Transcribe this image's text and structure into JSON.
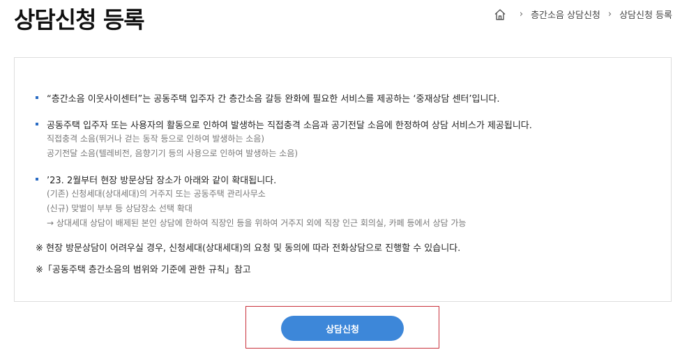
{
  "header": {
    "title": "상담신청 등록",
    "breadcrumb": {
      "home_icon": "home-icon",
      "items": [
        "층간소음 상담신청",
        "상담신청 등록"
      ]
    }
  },
  "notice": {
    "item1": "“층간소음 이웃사이센터”는 공동주택 입주자 간 층간소음 갈등 완화에 필요한 서비스를 제공하는 ‘중재상담 센터’입니다.",
    "item2": {
      "main": "공동주택 입주자 또는 사용자의 활동으로 인하여 발생하는 직접충격 소음과 공기전달 소음에 한정하여 상담 서비스가 제공됩니다.",
      "sub": [
        "직접충격 소음(뛰거나 걷는 동작 등으로 인하여 발생하는 소음)",
        "공기전달 소음(텔레비전, 음향기기 등의 사용으로 인하여 발생하는 소음)"
      ]
    },
    "item3": {
      "main": "’23. 2월부터 현장 방문상담 장소가 아래와 같이 확대됩니다.",
      "sub": [
        "(기존) 신청세대(상대세대)의 거주지 또는 공동주택 관리사무소",
        "(신규) 맞벌이 부부 등 상담장소 선택 확대",
        "→ 상대세대 상담이 배제된 본인 상담에 한하여 직장인 등을 위하여 거주지 외에 직장 인근 회의실, 카페 등에서 상담 가능"
      ]
    },
    "note1": "※ 현장 방문상담이 어려우실 경우, 신청세대(상대세대)의 요청 및 동의에 따라 전화상담으로 진행할 수 있습니다.",
    "note2": "※「공동주택 층간소음의 범위와 기준에 관한 규칙」참고"
  },
  "actions": {
    "apply_label": "상담신청"
  },
  "colors": {
    "accent": "#3d87d9",
    "bullet": "#2a6cc4",
    "highlight_border": "#c9303a"
  }
}
